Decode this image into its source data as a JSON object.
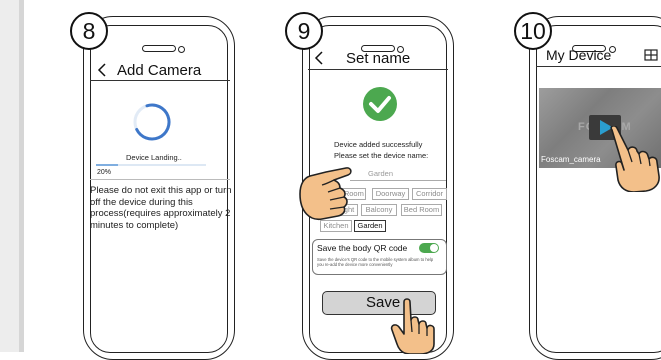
{
  "colors": {
    "accent": "#4ca84f",
    "spinner": "#3e77c9",
    "progress": "#7faee0",
    "video_button": "#2b9ecf",
    "hand": "#f3c08a"
  },
  "steps": [
    {
      "number": "8",
      "header": "Add Camera",
      "back_icon": "back-chevron-icon",
      "loading_label": "Device Landing..",
      "progress_percent": "20%",
      "progress_value": 0.2,
      "warning": "Please do not exit this app or turn off the device during this process(requires approximately 2 minutes to complete)"
    },
    {
      "number": "9",
      "header": "Set name",
      "back_icon": "back-chevron-icon",
      "success_icon": "check-circle-icon",
      "success_line1": "Device added successfully",
      "success_line2": "Please set the device name:",
      "name_input_value": "Garden",
      "name_options": [
        "Living Room",
        "Doorway",
        "Corridor",
        "Backlight",
        "Balcony",
        "Bed Room",
        "Kitchen",
        "Garden"
      ],
      "selected_option": "Garden",
      "qr_toggle_label": "Save the body QR code",
      "qr_toggle_on": true,
      "qr_description": "Save the device's QR code to the mobile system album to help you re-add the device more conveniently",
      "save_label": "Save"
    },
    {
      "number": "10",
      "header": "My Device",
      "grid_icon": "grid-view-icon",
      "camera_name": "Foscam_camera",
      "watermark": "FOSCAM",
      "play_icon": "play-icon"
    }
  ]
}
